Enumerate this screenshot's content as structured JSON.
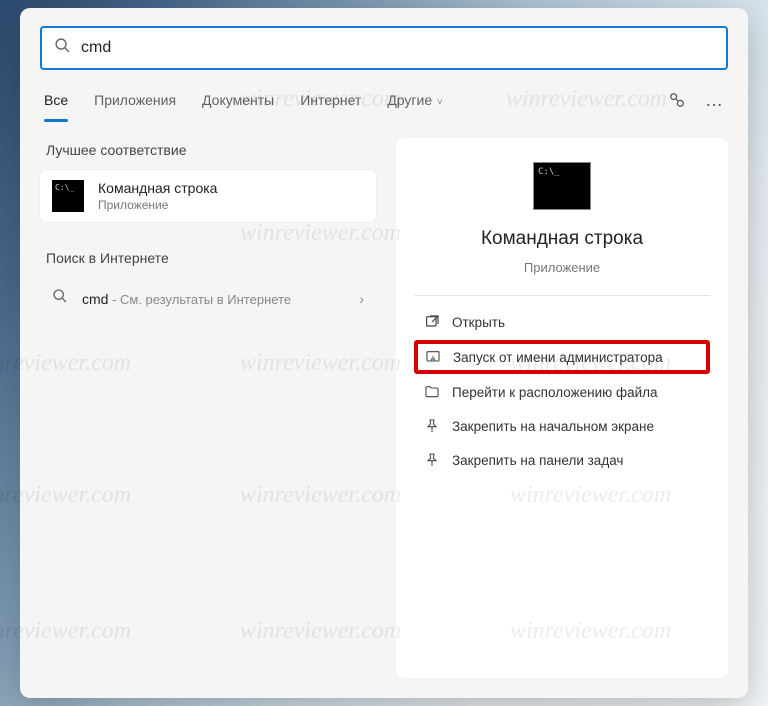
{
  "search": {
    "value": "cmd"
  },
  "tabs": [
    {
      "label": "Все",
      "active": true
    },
    {
      "label": "Приложения",
      "active": false
    },
    {
      "label": "Документы",
      "active": false
    },
    {
      "label": "Интернет",
      "active": false
    },
    {
      "label": "Другие",
      "active": false,
      "chevron": true
    }
  ],
  "left": {
    "best_match_title": "Лучшее соответствие",
    "result": {
      "title": "Командная строка",
      "subtitle": "Приложение"
    },
    "web_title": "Поиск в Интернете",
    "web_item": {
      "query": "cmd",
      "hint": " - См. результаты в Интернете"
    }
  },
  "preview": {
    "title": "Командная строка",
    "subtitle": "Приложение",
    "actions": {
      "open": "Открыть",
      "run_admin": "Запуск от имени администратора",
      "open_location": "Перейти к расположению файла",
      "pin_start": "Закрепить на начальном экране",
      "pin_taskbar": "Закрепить на панели задач"
    }
  },
  "watermark_text": "winreviewer.com"
}
